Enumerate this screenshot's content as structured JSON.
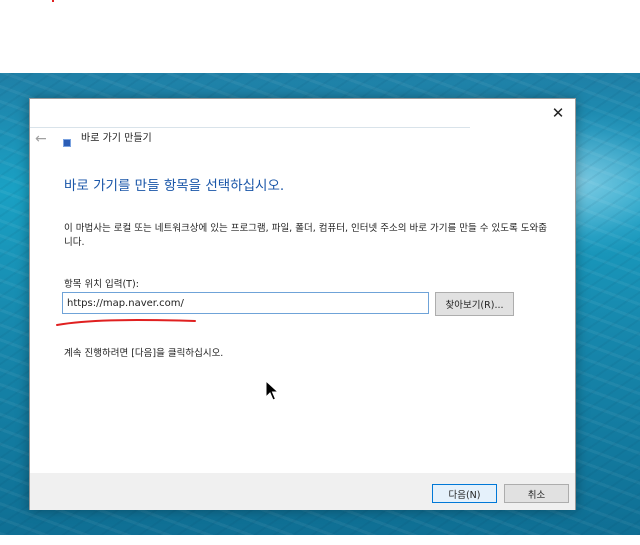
{
  "dialog": {
    "title": "바로 가기 만들기",
    "heading": "바로 가기를 만들 항목을 선택하십시오.",
    "description": "이 마법사는 로컬 또는 네트워크상에 있는 프로그램, 파일, 폴더, 컴퓨터, 인터넷 주소의 바로 가기를 만들 수 있도록 도와줍니다.",
    "location_label": "항목 위치 입력(T):",
    "location_value": "https://map.naver.com/",
    "browse_label": "찾아보기(R)...",
    "hint": "계속 진행하려면 [다음]을 클릭하십시오.",
    "next_label": "다음(N)",
    "cancel_label": "취소"
  },
  "icons": {
    "back": "back-arrow-icon",
    "close": "close-icon",
    "app": "shortcut-wizard-icon",
    "cursor": "mouse-cursor-icon"
  },
  "colors": {
    "heading": "#1a56a8",
    "input_border": "#6fa3d8",
    "annotation": "#e02020",
    "default_button_border": "#0078d7"
  }
}
